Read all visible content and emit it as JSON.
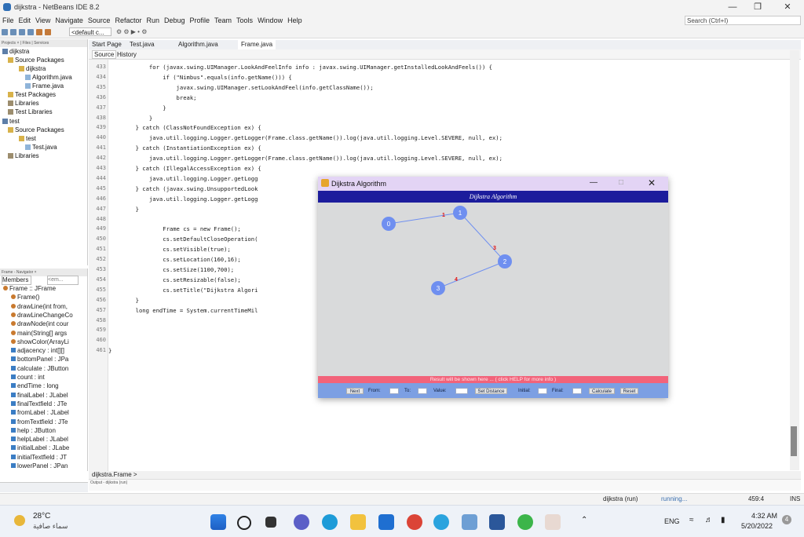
{
  "window": {
    "title": "dijkstra - NetBeans IDE 8.2"
  },
  "menus": [
    "File",
    "Edit",
    "View",
    "Navigate",
    "Source",
    "Refactor",
    "Run",
    "Debug",
    "Profile",
    "Team",
    "Tools",
    "Window",
    "Help"
  ],
  "search": {
    "placeholder": "Search (Ctrl+I)"
  },
  "toolbar": {
    "config": "<default c..."
  },
  "projects": {
    "tabs": "Projects × | Files | Services",
    "items": [
      "dijkstra",
      "Source Packages",
      "dijkstra",
      "Algorithm.java",
      "Frame.java",
      "Test Packages",
      "Libraries",
      "Test Libraries",
      "test",
      "Source Packages",
      "test",
      "Test.java",
      "Libraries"
    ]
  },
  "navigator": {
    "tabs": "Frame - Navigator ×",
    "filter": "Members",
    "filter2": "<em...",
    "items": [
      "Frame :: JFrame",
      "Frame()",
      "drawLine(int from,",
      "drawLineChangeCo",
      "drawNode(int cour",
      "main(String[] args",
      "showColor(ArrayLi",
      "adjacency : int[][]",
      "bottomPanel : JPa",
      "calculate : JButton",
      "count : int",
      "endTime : long",
      "finalLabel : JLabel",
      "finalTextfield : JTe",
      "fromLabel : JLabel",
      "fromTextfield : JTe",
      "help : JButton",
      "helpLabel : JLabel",
      "initialLabel : JLabe",
      "initialTextfield : JT",
      "lowerPanel : JPan"
    ]
  },
  "editor": {
    "tabs": [
      "Start Page",
      "Test.java",
      "Algorithm.java",
      "Frame.java"
    ],
    "source_tab": "Source",
    "history_tab": "History",
    "line_numbers": [
      "433",
      "434",
      "435",
      "436",
      "437",
      "438",
      "439",
      "440",
      "441",
      "442",
      "443",
      "444",
      "445",
      "446",
      "447",
      "448",
      "449",
      "450",
      "451",
      "452",
      "453",
      "454",
      "455",
      "456",
      "457",
      "458",
      "459",
      "460",
      "461"
    ],
    "lines": [
      "            for (javax.swing.UIManager.LookAndFeelInfo info : javax.swing.UIManager.getInstalledLookAndFeels()) {",
      "                if (\"Nimbus\".equals(info.getName())) {",
      "                    javax.swing.UIManager.setLookAndFeel(info.getClassName());",
      "                    break;",
      "                }",
      "            }",
      "        } catch (ClassNotFoundException ex) {",
      "            java.util.logging.Logger.getLogger(Frame.class.getName()).log(java.util.logging.Level.SEVERE, null, ex);",
      "        } catch (InstantiationException ex) {",
      "            java.util.logging.Logger.getLogger(Frame.class.getName()).log(java.util.logging.Level.SEVERE, null, ex);",
      "        } catch (IllegalAccessException ex) {",
      "            java.util.logging.Logger.getLogg",
      "        } catch (javax.swing.UnsupportedLook",
      "            java.util.logging.Logger.getLogg",
      "        }",
      "",
      "                Frame cs = new Frame();",
      "                cs.setDefaultCloseOperation(",
      "                cs.setVisible(true);",
      "                cs.setLocation(160,16);",
      "                cs.setSize(1100,700);",
      "                cs.setResizable(false);",
      "                cs.setTitle(\"Dijkstra Algori",
      "        }",
      "        long endTime = System.currentTimeMil",
      "",
      "",
      "",
      "}"
    ],
    "breadcrumb": "dijkstra.Frame >",
    "output_tab": "Output - dijkstra (run)"
  },
  "status": {
    "run": "dijkstra (run)",
    "state": "running...",
    "position": "459:4",
    "mode": "INS"
  },
  "dialog": {
    "title": "Dijkstra Algorithm",
    "heading": "Dijkstra Algorithm",
    "result": "Result will be shown here ...  ( click HELP for more info )",
    "controls": {
      "next": "Next",
      "from": "From:",
      "to": "To:",
      "value": "Value:",
      "set_distance": "Set Distance",
      "initial": "Initial:",
      "final": "Final:",
      "calculate": "Calculate",
      "reset": "Reset"
    },
    "colors": {
      "heading_bg": "#1c1c9c",
      "result_bg": "#f2637a",
      "controls_bg": "#7c9fe3",
      "node": "#6f8ff0",
      "weight": "#e11010"
    },
    "graph": {
      "nodes": [
        {
          "id": "0",
          "label": "0"
        },
        {
          "id": "1",
          "label": "1"
        },
        {
          "id": "2",
          "label": "2"
        },
        {
          "id": "3",
          "label": "3"
        }
      ],
      "edges": [
        {
          "from": "0",
          "to": "1",
          "weight": "1"
        },
        {
          "from": "1",
          "to": "2",
          "weight": "3"
        },
        {
          "from": "2",
          "to": "3",
          "weight": "4"
        }
      ]
    }
  },
  "taskbar": {
    "temperature": "28°C",
    "weather": "سماء صافية",
    "language": "ENG",
    "time": "4:32 AM",
    "date": "5/20/2022",
    "notifications": "4"
  }
}
